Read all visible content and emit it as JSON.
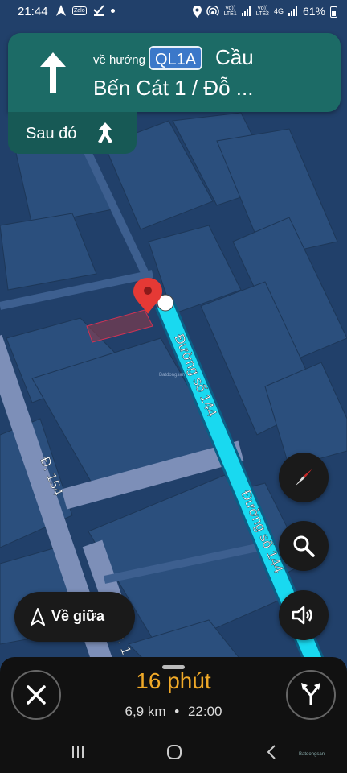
{
  "status_bar": {
    "time": "21:44",
    "left_icons": [
      "navigation-arrow-icon",
      "zalo-icon",
      "download-check-icon",
      "dot-icon"
    ],
    "zalo_label": "Zalo",
    "right_icons": [
      "location-icon",
      "hotspot-icon",
      "signal-icon",
      "battery-icon"
    ],
    "sim1_volte": "Vo))",
    "sim1_lte": "LTE1",
    "sim2_volte": "Vo))",
    "sim2_lte": "LTE2",
    "network": "4G",
    "battery": "61%"
  },
  "navigation": {
    "toward_label": "về hướng",
    "route_shield": "QL1A",
    "destination_line1": "Cầu",
    "destination_line2": "Bến Cát 1 / Đỗ ...",
    "then_label": "Sau đó",
    "colors": {
      "card": "#1c6b66",
      "shield": "#3b78c9",
      "route": "#19d9f0",
      "eta": "#f0a928"
    }
  },
  "map": {
    "street_labels": [
      "Đường số 144",
      "Đường số 144",
      "Đ. 154",
      "Đ. 1"
    ],
    "watermark": "Batdongsan"
  },
  "controls": {
    "recenter_label": "Về giữa",
    "compass": "compass-icon",
    "search": "search-icon",
    "sound": "volume-icon"
  },
  "trip": {
    "eta_duration": "16 phút",
    "distance": "6,9 km",
    "separator": "•",
    "arrival_time": "22:00"
  },
  "system_nav": {
    "recents": "recents-icon",
    "home": "home-icon",
    "back": "back-icon"
  },
  "corner_watermark": "Batdongsan"
}
